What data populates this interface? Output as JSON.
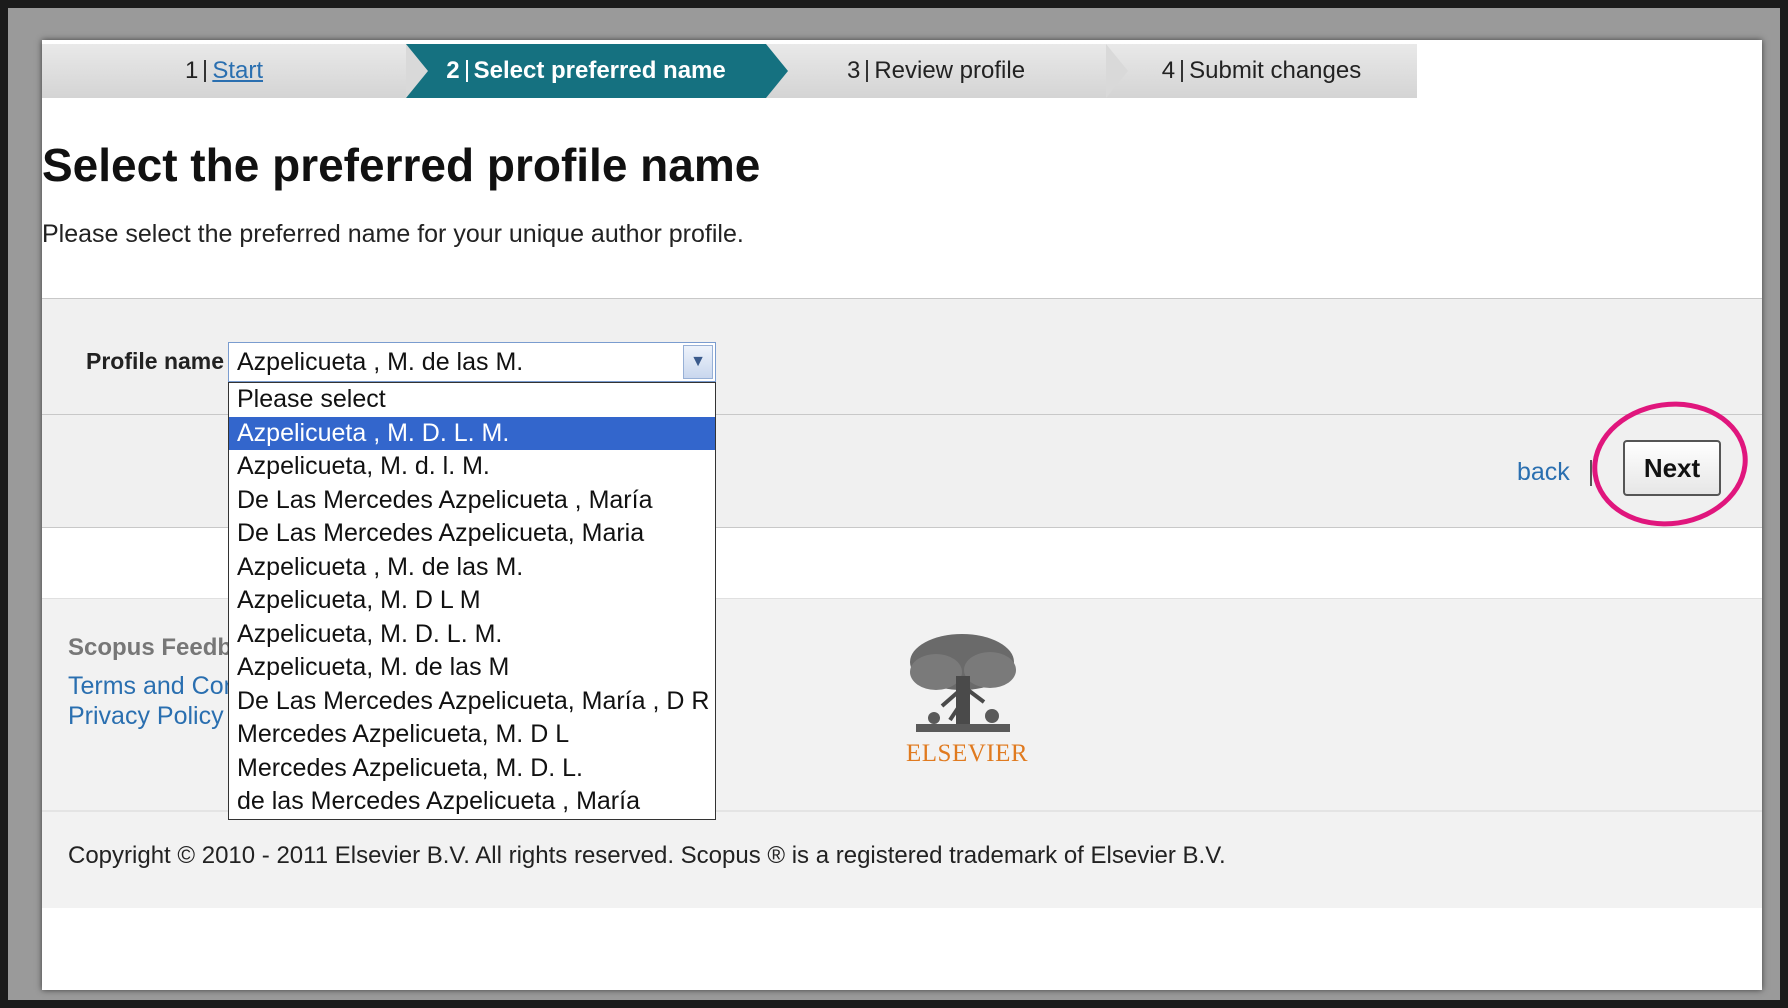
{
  "stepper": {
    "steps": [
      {
        "num": "1",
        "label": "Start"
      },
      {
        "num": "2",
        "label": "Select preferred name"
      },
      {
        "num": "3",
        "label": "Review profile"
      },
      {
        "num": "4",
        "label": "Submit changes"
      }
    ]
  },
  "main": {
    "title": "Select the preferred profile name",
    "subtitle": "Please select the preferred name for your unique author profile."
  },
  "form": {
    "profile_label": "Profile name",
    "selected_value": "Azpelicueta , M. de las M.",
    "options": [
      "Please select",
      "Azpelicueta , M. D. L. M.",
      "Azpelicueta, M. d. l. M.",
      "De Las Mercedes Azpelicueta , María",
      "De Las Mercedes Azpelicueta, Maria",
      "Azpelicueta , M. de las M.",
      "Azpelicueta, M. D L M",
      "Azpelicueta, M. D. L. M.",
      "Azpelicueta, M. de las M",
      "De Las Mercedes Azpelicueta, María , D R",
      "Mercedes Azpelicueta, M. D L",
      "Mercedes Azpelicueta, M. D. L.",
      "de las Mercedes Azpelicueta , María"
    ],
    "highlighted_index": 1,
    "back_label": "back",
    "next_label": "Next"
  },
  "footer": {
    "feedback": "Scopus Feedb",
    "terms": "Terms and Con",
    "privacy": "Privacy Policy",
    "logo_text": "ELSEVIER",
    "copyright": "Copyright © 2010 - 2011 Elsevier B.V. All rights reserved. Scopus ® is a registered trademark of Elsevier B.V."
  },
  "colors": {
    "active_step": "#157180",
    "link": "#2a6fb0",
    "highlight_ring": "#e0167d",
    "selected_option": "#3366cc",
    "logo": "#e07a1f"
  }
}
